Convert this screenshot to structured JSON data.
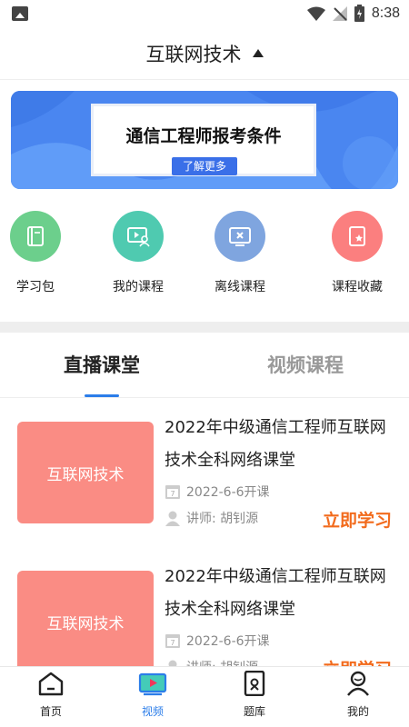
{
  "status_bar": {
    "time": "8:38"
  },
  "header": {
    "title": "互联网技术"
  },
  "banner": {
    "headline": "通信工程师报考条件",
    "button": "了解更多"
  },
  "quick_menu": [
    {
      "label": "学习包",
      "icon": "book-icon",
      "color": "#6ccf8c"
    },
    {
      "label": "我的课程",
      "icon": "my-course-icon",
      "color": "#4fcab0"
    },
    {
      "label": "离线课程",
      "icon": "offline-course-icon",
      "color": "#7fa5df"
    },
    {
      "label": "课程收藏",
      "icon": "favorite-icon",
      "color": "#fb7f7f"
    }
  ],
  "tabs": [
    {
      "label": "直播课堂",
      "active": true
    },
    {
      "label": "视频课程",
      "active": false
    }
  ],
  "courses": [
    {
      "thumb_text": "互联网技术",
      "title": "2022年中级通信工程师互联网技术全科网络课堂",
      "date": "2022-6-6开课",
      "teacher": "讲师:  胡钊源",
      "action": "立即学习"
    },
    {
      "thumb_text": "互联网技术",
      "title": "2022年中级通信工程师互联网技术全科网络课堂",
      "date": "2022-6-6开课",
      "teacher": "讲师:  胡钊源",
      "action": "立即学习"
    }
  ],
  "bottom_nav": [
    {
      "label": "首页",
      "icon": "home-icon",
      "active": false
    },
    {
      "label": "视频",
      "icon": "video-icon",
      "active": true
    },
    {
      "label": "题库",
      "icon": "question-bank-icon",
      "active": false
    },
    {
      "label": "我的",
      "icon": "profile-icon",
      "active": false
    }
  ],
  "colors": {
    "accent": "#2b7de9",
    "action": "#f26b1d",
    "thumb": "#fa8c84",
    "banner": "#4a86f0"
  }
}
